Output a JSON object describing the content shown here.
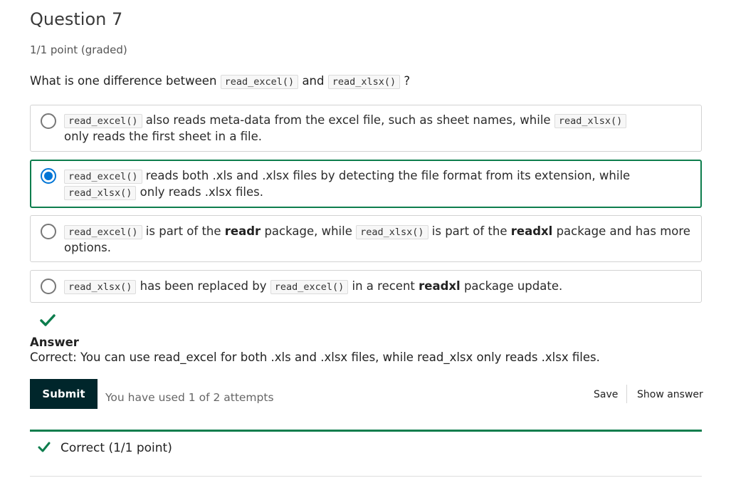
{
  "question": {
    "title": "Question 7",
    "points": "1/1 point (graded)",
    "prompt_pre": "What is one difference between ",
    "prompt_code1": "read_excel()",
    "prompt_mid": " and ",
    "prompt_code2": "read_xlsx()",
    "prompt_post": " ?"
  },
  "options": [
    {
      "selected": false,
      "code1": "read_excel()",
      "text1": " also reads meta-data from the excel file, such as sheet names, while ",
      "code2": "read_xlsx()",
      "text2": "only reads the first sheet in a file."
    },
    {
      "selected": true,
      "code1": "read_excel()",
      "text1": " reads both .xls and .xlsx files by detecting the file format from its extension, while",
      "code2": "read_xlsx()",
      "text2": " only reads .xlsx files."
    },
    {
      "selected": false,
      "code1": "read_excel()",
      "text1": " is part of the ",
      "bold1": "readr",
      "text2": " package, while ",
      "code2": "read_xlsx()",
      "text3": " is part of the ",
      "bold2": "readxl",
      "text4": " package and has more options."
    },
    {
      "selected": false,
      "code1": "read_xlsx()",
      "text1": " has been replaced by ",
      "code2": "read_excel()",
      "text2": " in a recent ",
      "bold1": "readxl",
      "text3": " package update."
    }
  ],
  "answer": {
    "heading": "Answer",
    "body": "Correct:  You can use read_excel for both .xls and .xlsx files, while read_xlsx only reads .xlsx files."
  },
  "actions": {
    "submit_label": "Submit",
    "attempts_text": "You have used 1 of 2 attempts",
    "save_label": "Save",
    "show_answer_label": "Show answer"
  },
  "notification": {
    "text": "Correct (1/1 point)"
  },
  "colors": {
    "success_green": "#0d7d4d",
    "radio_blue": "#0075d6",
    "submit_bg": "#00262b"
  },
  "icons": {
    "check": "check-icon"
  }
}
